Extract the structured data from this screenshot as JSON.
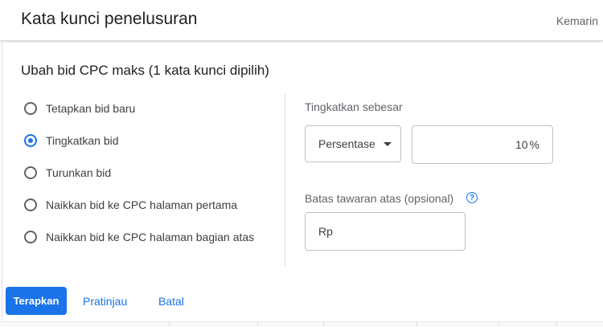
{
  "header": {
    "title": "Kata kunci penelusuran",
    "right_text": "Kemarin"
  },
  "panel": {
    "title": "Ubah bid CPC maks (1 kata kunci dipilih)",
    "options": [
      {
        "label": "Tetapkan bid baru",
        "checked": false
      },
      {
        "label": "Tingkatkan bid",
        "checked": true
      },
      {
        "label": "Turunkan bid",
        "checked": false
      },
      {
        "label": "Naikkan bid ke CPC halaman pertama",
        "checked": false
      },
      {
        "label": "Naikkan bid ke CPC halaman bagian atas",
        "checked": false
      }
    ],
    "increase_by_label": "Tingkatkan sebesar",
    "mode_select": "Persentase",
    "amount_value": "10",
    "amount_unit": "%",
    "max_bid_label": "Batas tawaran atas (opsional)",
    "currency_prefix": "Rp"
  },
  "actions": {
    "apply": "Terapkan",
    "preview": "Pratinjau",
    "cancel": "Batal"
  },
  "colors": {
    "accent": "#1a73e8"
  }
}
